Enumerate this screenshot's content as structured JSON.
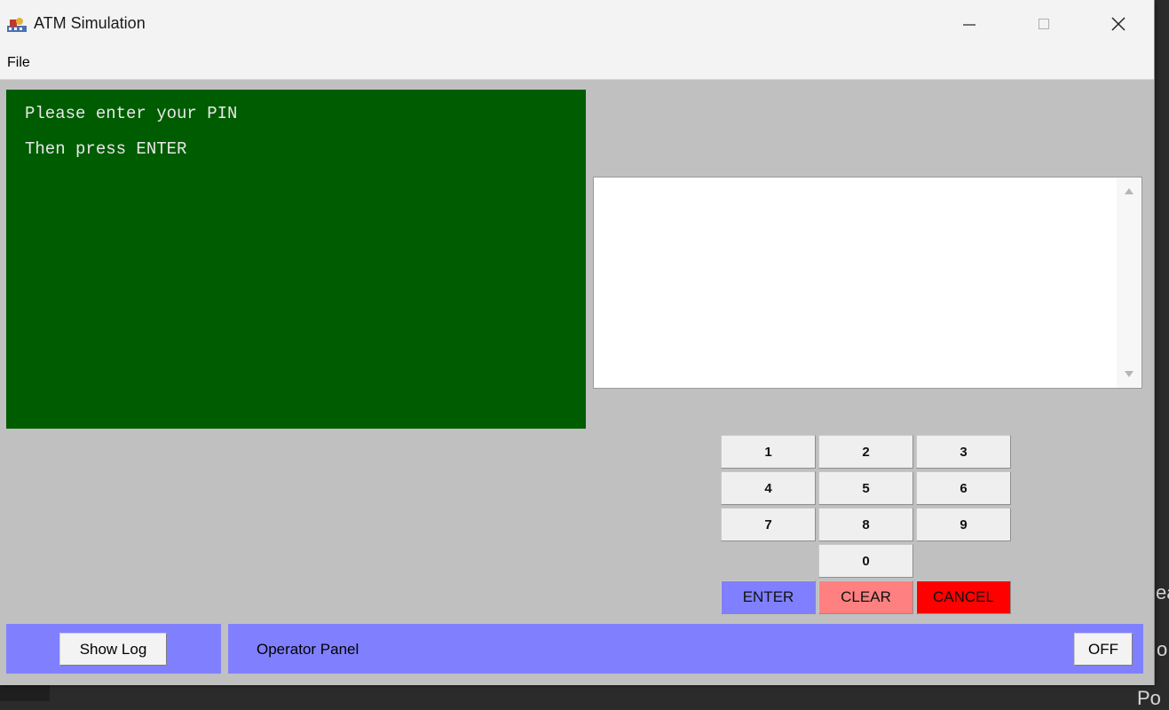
{
  "window": {
    "title": "ATM Simulation",
    "icon": "atm-app-icon",
    "controls": {
      "minimize": "minimize-icon",
      "maximize": "maximize-icon",
      "close": "close-icon"
    }
  },
  "menu": {
    "file": "File"
  },
  "display": {
    "lines": [
      "Please enter your PIN",
      "Then press ENTER"
    ],
    "color": "#005c00"
  },
  "keypad": {
    "digits": [
      "1",
      "2",
      "3",
      "4",
      "5",
      "6",
      "7",
      "8",
      "9",
      "0"
    ],
    "enter": "ENTER",
    "clear": "CLEAR",
    "cancel": "CANCEL",
    "colors": {
      "enter": "#7f7fff",
      "clear": "#ff8080",
      "cancel": "#ff0000"
    }
  },
  "bottom": {
    "show_log": "Show Log",
    "operator_panel": "Operator Panel",
    "off": "OFF",
    "panel_color": "#8080ff"
  },
  "background_fragments": [
    "ea",
    "o",
    "Po"
  ]
}
